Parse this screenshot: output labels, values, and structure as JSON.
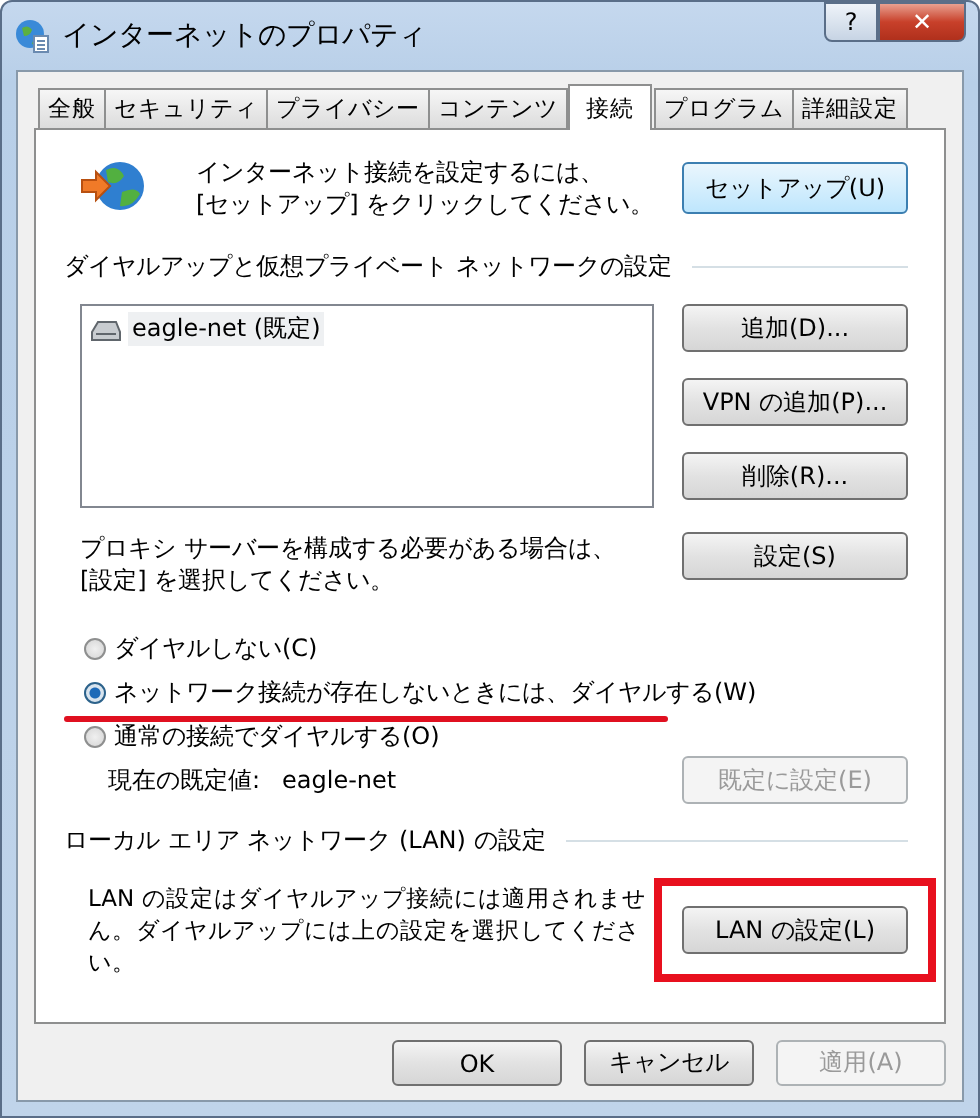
{
  "window": {
    "title": "インターネットのプロパティ",
    "help": "?",
    "close": "✕"
  },
  "tabs": [
    {
      "label": "全般",
      "selected": false
    },
    {
      "label": "セキュリティ",
      "selected": false
    },
    {
      "label": "プライバシー",
      "selected": false
    },
    {
      "label": "コンテンツ",
      "selected": false
    },
    {
      "label": "接続",
      "selected": true
    },
    {
      "label": "プログラム",
      "selected": false
    },
    {
      "label": "詳細設定",
      "selected": false
    }
  ],
  "setup": {
    "text": "インターネット接続を設定するには、\n[セットアップ] をクリックしてください。",
    "button": "セットアップ(U)"
  },
  "dialup": {
    "heading": "ダイヤルアップと仮想プライベート ネットワークの設定",
    "connections": [
      {
        "name": "eagle-net (既定)",
        "selected": true
      }
    ],
    "buttons": [
      {
        "label": "追加(D)...",
        "disabled": false
      },
      {
        "label": "VPN の追加(P)...",
        "disabled": false
      },
      {
        "label": "削除(R)...",
        "disabled": false
      }
    ],
    "proxy_text": "プロキシ サーバーを構成する必要がある場合は、\n[設定] を選択してください。",
    "proxy_button": "設定(S)",
    "options": [
      {
        "label": "ダイヤルしない(C)",
        "selected": false
      },
      {
        "label": "ネットワーク接続が存在しないときには、ダイヤルする(W)",
        "selected": true,
        "annotation": {
          "kind": "underline",
          "color": "#e01020"
        }
      },
      {
        "label": "通常の接続でダイヤルする(O)",
        "selected": false
      }
    ],
    "default_label": "現在の既定値:",
    "default_value": "eagle-net",
    "default_button": {
      "label": "既定に設定(E)",
      "disabled": true
    }
  },
  "lan": {
    "heading": "ローカル エリア ネットワーク (LAN) の設定",
    "text": "LAN の設定はダイヤルアップ接続には適用されません。ダイヤルアップには上の設定を選択してください。",
    "button": "LAN の設定(L)",
    "button_annotation": {
      "kind": "box",
      "color": "#e8101e"
    }
  },
  "buttons": [
    {
      "label": "OK",
      "disabled": false
    },
    {
      "label": "キャンセル",
      "disabled": false
    },
    {
      "label": "適用(A)",
      "disabled": true
    }
  ]
}
